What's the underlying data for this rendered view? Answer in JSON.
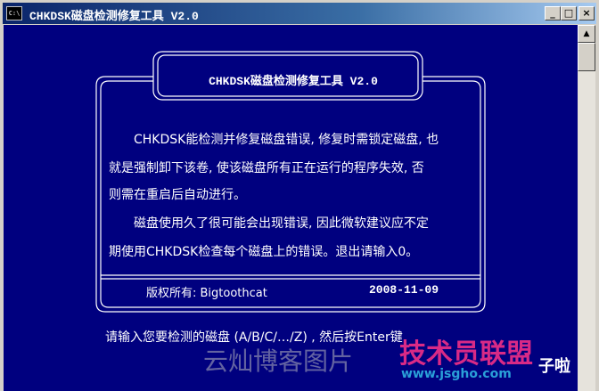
{
  "window": {
    "title": "CHKDSK磁盘检测修复工具 V2.0",
    "icon_text": "C:\\",
    "buttons": {
      "minimize": "_",
      "maximize": "□",
      "close": "×"
    }
  },
  "console": {
    "heading": "CHKDSK磁盘检测修复工具 V2.0",
    "lines": [
      "CHKDSK能检测并修复磁盘错误, 修复时需锁定磁盘, 也",
      "就是强制卸下该卷, 使该磁盘所有正在运行的程序失效, 否",
      "则需在重启后自动进行。",
      "磁盘使用久了很可能会出现错误, 因此微软建议应不定",
      "期使用CHKDSK检查每个磁盘上的错误。退出请输入0。"
    ],
    "footer": {
      "owner": "版权所有: Bigtoothcat",
      "date": "2008-11-09"
    },
    "prompt": "请输入您要检测的磁盘 (A/B/C/…/Z) , 然后按Enter键"
  },
  "watermarks": {
    "site_name": "云灿博客图片",
    "brand": "技术员联盟",
    "brand_suffix": "子啦",
    "url": "www.jsgho.com"
  },
  "colors": {
    "console_bg": "#00007f",
    "console_text": "#ffffff",
    "title_bar": "#0a246a"
  }
}
